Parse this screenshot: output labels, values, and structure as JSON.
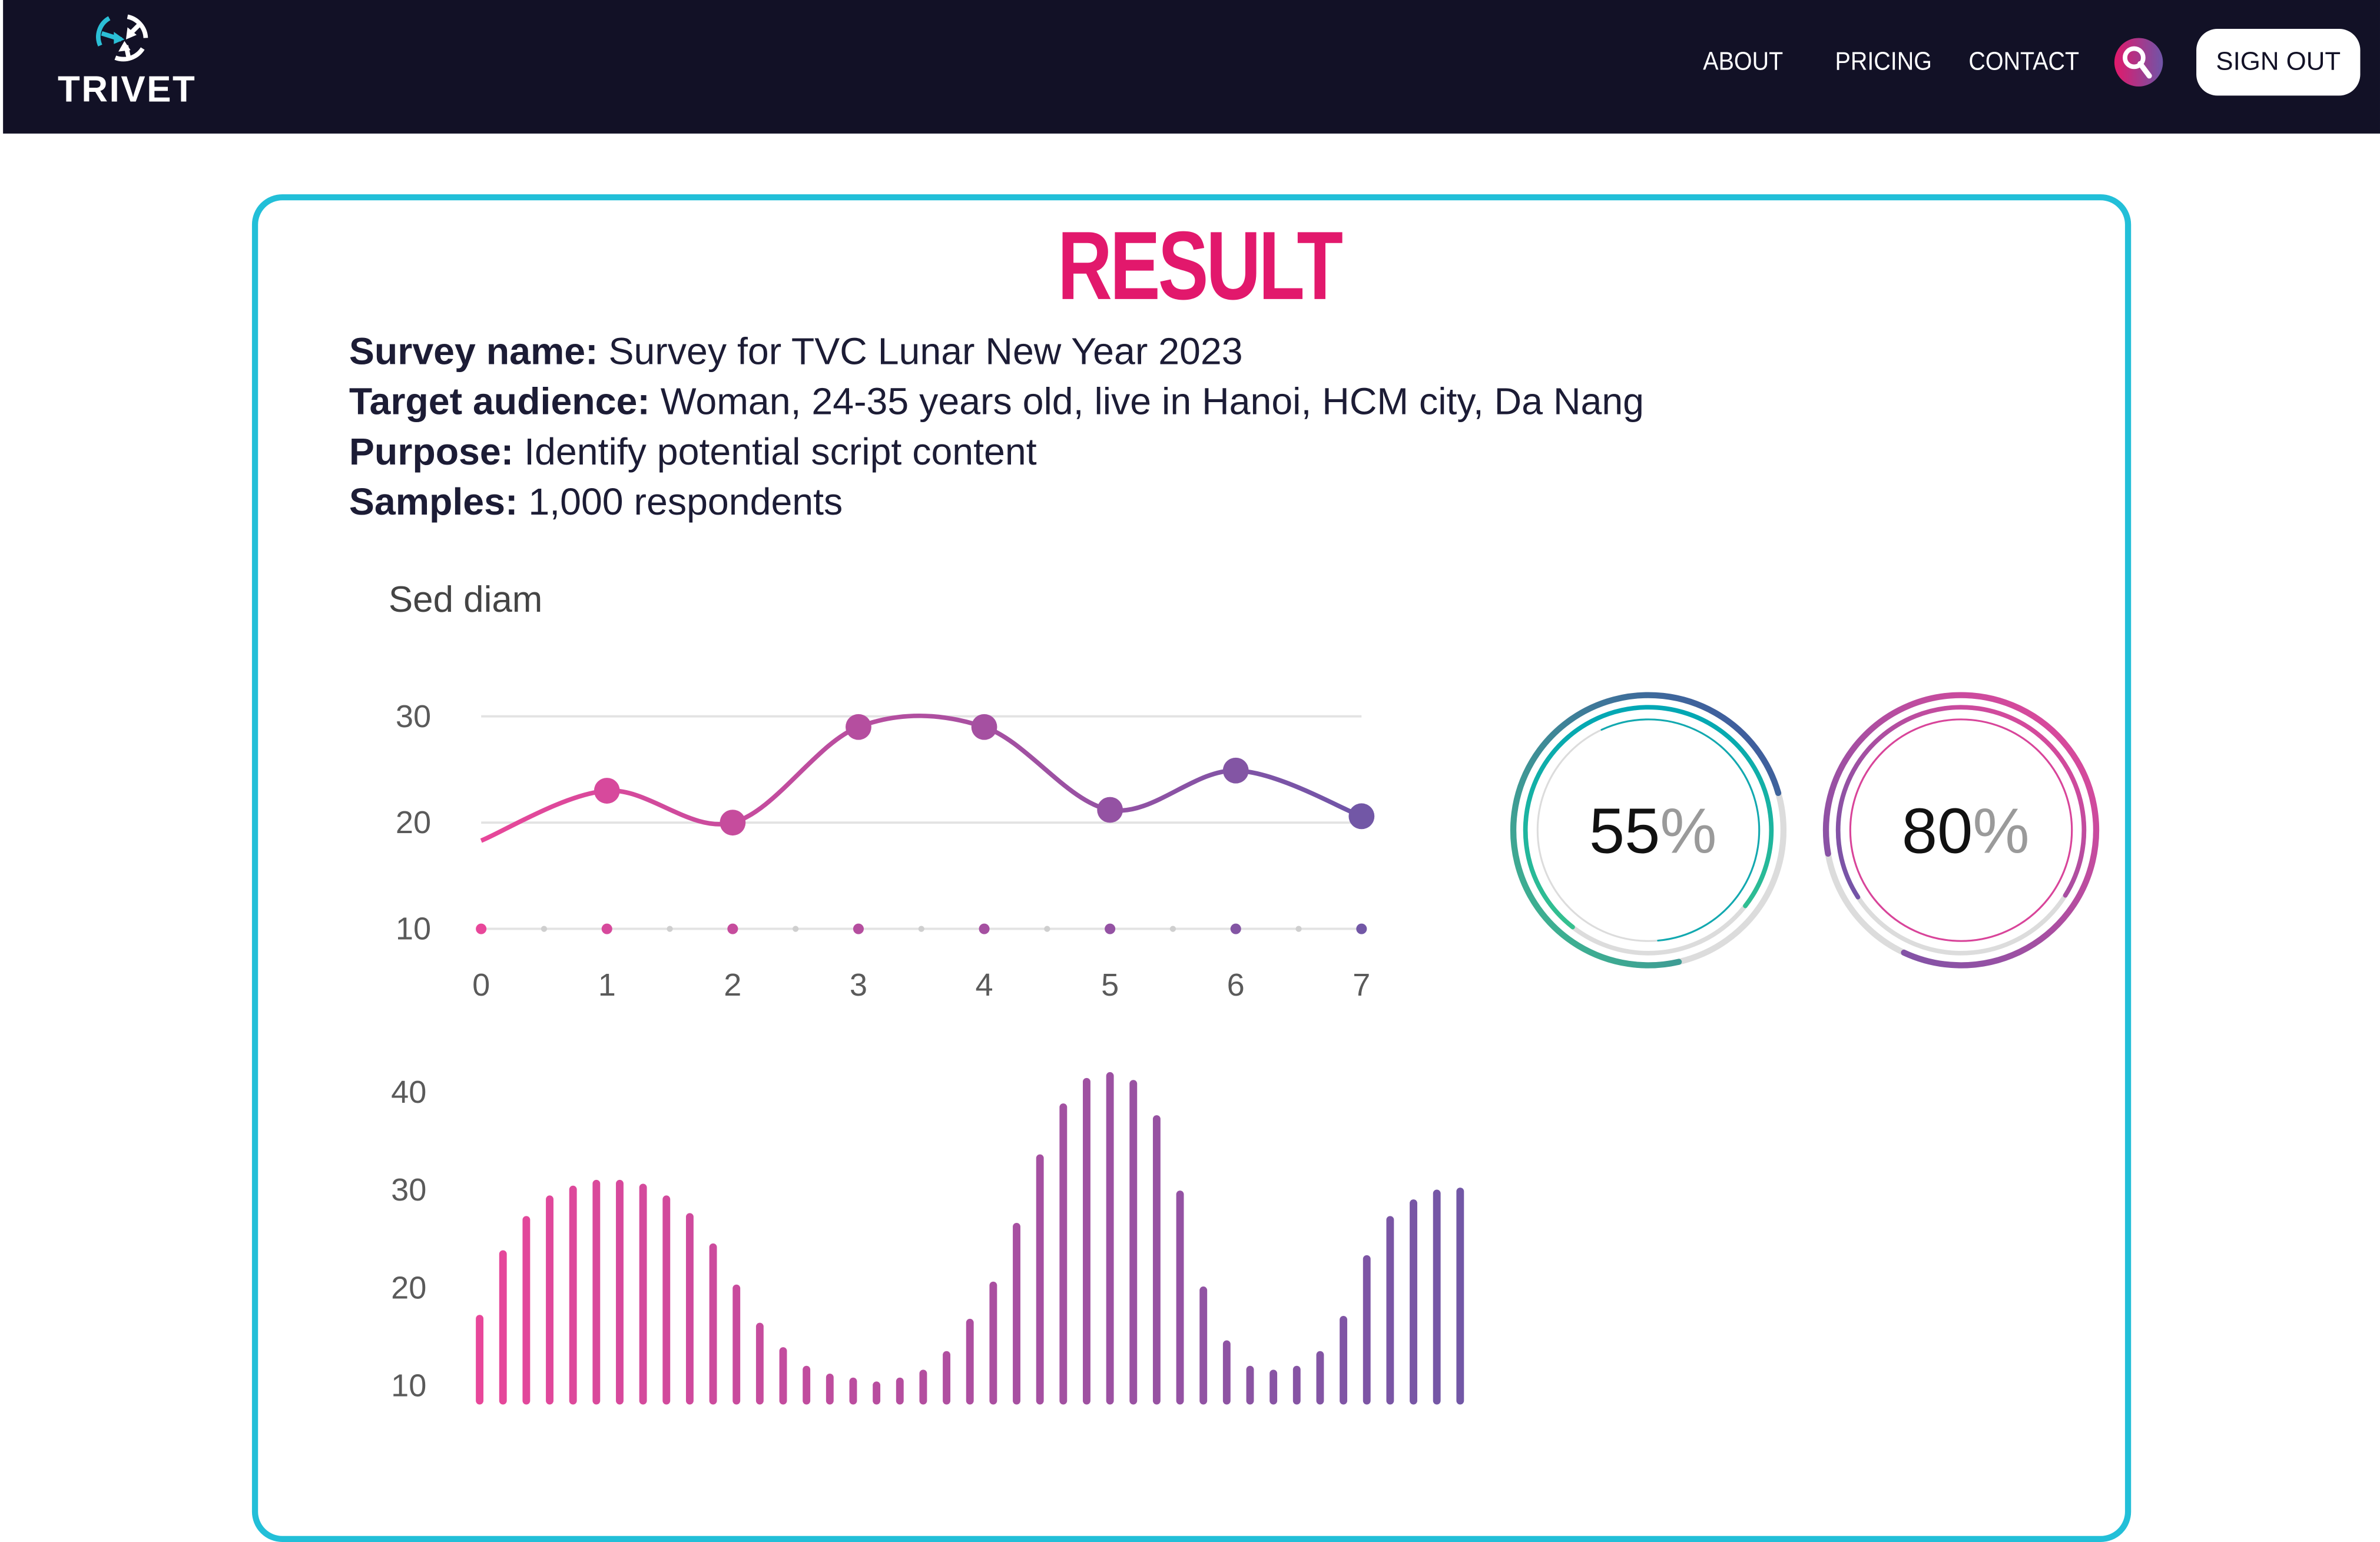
{
  "header": {
    "logo_text": "TRIVET",
    "nav": [
      "ABOUT",
      "PRICING",
      "CONTACT"
    ],
    "search_icon": "search-icon",
    "sign_out": "SIGN OUT"
  },
  "result": {
    "title": "RESULT",
    "info": [
      {
        "label": "Survey name:",
        "value": " Survey for TVC Lunar New Year 2023"
      },
      {
        "label": "Target audience:",
        "value": " Woman, 24-35 years old, live in Hanoi, HCM city, Da Nang"
      },
      {
        "label": "Purpose:",
        "value": " Identify potential script content"
      },
      {
        "label": "Samples:",
        "value": " 1,000 respondents"
      }
    ]
  },
  "colors": {
    "accent": "#e2186c",
    "border": "#22bfd8",
    "header_bg": "#121126",
    "pink": "#e8479a",
    "purple": "#7257a6"
  },
  "chart_data": [
    {
      "type": "line",
      "title": "Sed diam",
      "x": [
        0,
        1,
        2,
        3,
        4,
        5,
        6,
        7
      ],
      "values": [
        18.3,
        23,
        20,
        29,
        29,
        21.2,
        24.9,
        20.6
      ],
      "yticks": [
        10,
        20,
        30
      ],
      "xticks": [
        "0",
        "1",
        "2",
        "3",
        "4",
        "5",
        "6",
        "7"
      ],
      "ylim": [
        10,
        30
      ],
      "grid": true
    },
    {
      "type": "gauge",
      "series": [
        {
          "name": "gauge-1",
          "value": 55,
          "label": "55",
          "unit": "%"
        },
        {
          "name": "gauge-2",
          "value": 80,
          "label": "80",
          "unit": "%"
        }
      ]
    },
    {
      "type": "bar",
      "yticks": [
        10,
        20,
        30,
        40
      ],
      "ylim": [
        8,
        42
      ],
      "values": [
        17.0,
        23.6,
        27.1,
        29.2,
        30.2,
        30.8,
        30.8,
        30.4,
        29.2,
        27.4,
        24.3,
        20.1,
        16.2,
        13.7,
        11.8,
        11.0,
        10.6,
        10.2,
        10.6,
        11.4,
        13.3,
        16.6,
        20.4,
        26.4,
        33.4,
        38.6,
        41.2,
        41.8,
        41.0,
        37.4,
        29.7,
        19.9,
        14.4,
        11.8,
        11.4,
        11.8,
        13.3,
        16.9,
        23.1,
        27.1,
        28.8,
        29.8,
        30.0
      ]
    }
  ]
}
